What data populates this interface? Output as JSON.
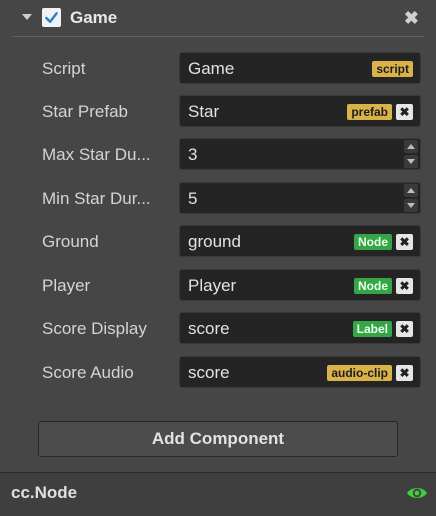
{
  "component": {
    "title": "Game",
    "enabled": true
  },
  "properties": [
    {
      "label": "Script",
      "value": "Game",
      "tag": "script",
      "tag_color": "yellow",
      "has_clear": false
    },
    {
      "label": "Star Prefab",
      "value": "Star",
      "tag": "prefab",
      "tag_color": "yellow",
      "has_clear": true
    },
    {
      "label": "Max Star Du...",
      "value": "3",
      "control": "number-stepper"
    },
    {
      "label": "Min Star Dur...",
      "value": "5",
      "control": "number-stepper"
    },
    {
      "label": "Ground",
      "value": "ground",
      "tag": "Node",
      "tag_color": "green",
      "has_clear": true
    },
    {
      "label": "Player",
      "value": "Player",
      "tag": "Node",
      "tag_color": "green",
      "has_clear": true
    },
    {
      "label": "Score Display",
      "value": "score",
      "tag": "Label",
      "tag_color": "green",
      "has_clear": true
    },
    {
      "label": "Score Audio",
      "value": "score",
      "tag": "audio-clip",
      "tag_color": "yellow",
      "has_clear": true
    }
  ],
  "clear_symbol": "✖",
  "add_component_label": "Add Component",
  "footer": {
    "label": "cc.Node"
  },
  "icons": {
    "collapse": "triangle-down-icon",
    "checkbox": "checkmark-icon",
    "close": "close-icon",
    "visibility": "eye-icon"
  },
  "colors": {
    "panel_bg": "#464646",
    "field_bg": "#242424",
    "tag_yellow": "#d9b24a",
    "tag_green": "#36a548",
    "checkbox_blue": "#2a7fd4",
    "eye_green": "#3ecf3e"
  }
}
